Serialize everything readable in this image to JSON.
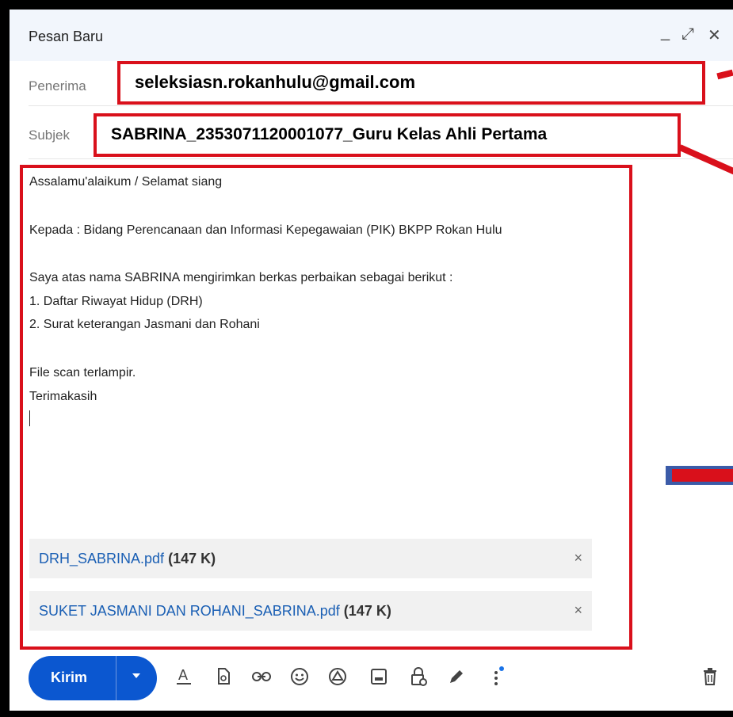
{
  "window": {
    "title": "Pesan Baru",
    "controls": {
      "minimize": "_",
      "expand": "⤢",
      "close": "✕"
    }
  },
  "recipient": {
    "label": "Penerima",
    "value": "seleksiasn.rokanhulu@gmail.com"
  },
  "subject": {
    "label": "Subjek",
    "value": "SABRINA_2353071120001077_Guru   Kelas Ahli Pertama"
  },
  "body": {
    "lines": [
      "Assalamu'alaikum / Selamat siang",
      "Kepada : Bidang Perencanaan dan Informasi Kepegawaian (PIK) BKPP Rokan Hulu",
      "Saya atas nama SABRINA mengirimkan berkas perbaikan sebagai berikut :",
      "1. Daftar Riwayat Hidup (DRH)",
      "2. Surat keterangan Jasmani dan Rohani",
      "File scan terlampir.",
      "Terimakasih"
    ]
  },
  "attachments": [
    {
      "name": "DRH_SABRINA.pdf",
      "size": "(147 K)",
      "remove": "×"
    },
    {
      "name": "SUKET JASMANI DAN ROHANI_SABRINA.pdf",
      "size": "(147 K)",
      "remove": "×"
    }
  ],
  "toolbar": {
    "send_label": "Kirim",
    "send_options_icon": "caret-down-icon",
    "icons": [
      "text-format-icon",
      "attach-file-icon",
      "insert-link-icon",
      "emoji-icon",
      "google-drive-icon",
      "insert-photo-icon",
      "confidential-mode-icon",
      "signature-icon",
      "more-options-icon",
      "delete-icon"
    ]
  },
  "colors": {
    "send_button": "#0b57d0",
    "annotation_red": "#d9101b",
    "attachment_link": "#1a5fb4"
  }
}
